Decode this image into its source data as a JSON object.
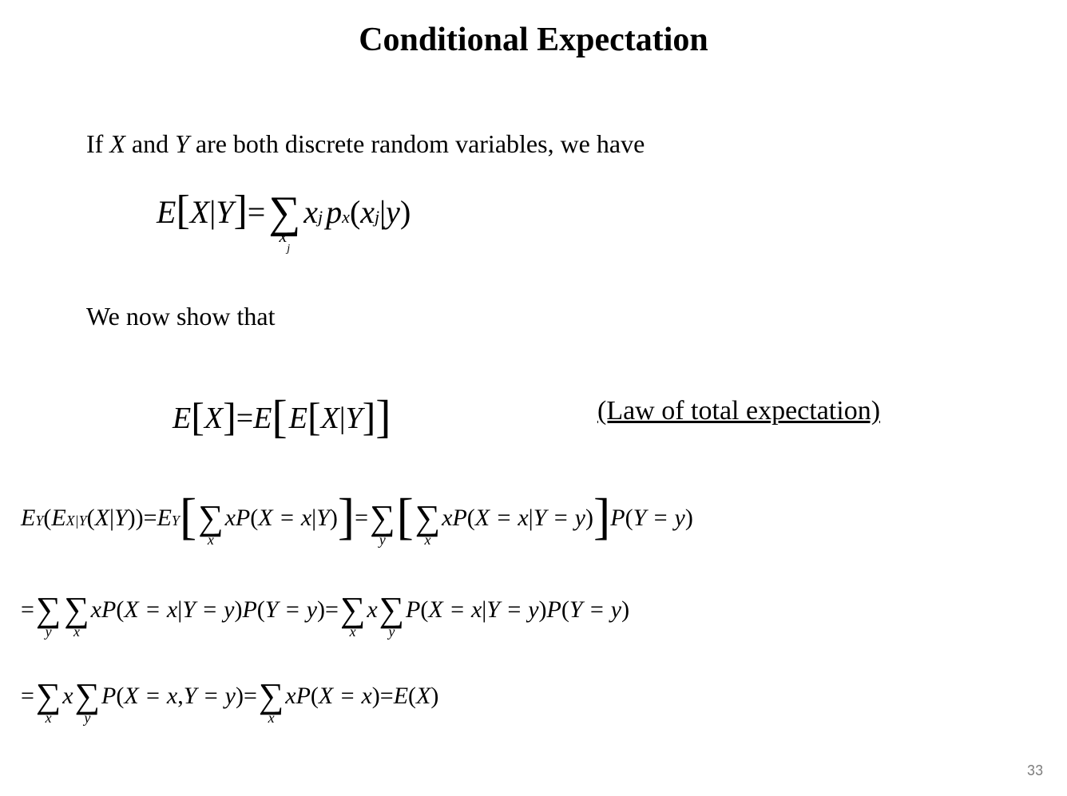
{
  "title": "Conditional Expectation",
  "intro_prefix": "If ",
  "intro_X": "X",
  "intro_mid": " and ",
  "intro_Y": "Y",
  "intro_suffix": " are both discrete random variables, we have",
  "we_now_show": "We now show that",
  "eq1": {
    "E": "E",
    "lb": "[",
    "X": "X",
    "bar": " | ",
    "Y": "Y",
    "rb": "]",
    "eq": " = ",
    "sigma": "∑",
    "sigma_sub": "x",
    "sigma_sub_j": "j",
    "xj_x": "x",
    "xj_j": "j",
    "p": "p",
    "p_sub": "x",
    "lp": "(",
    "arg_x": "x",
    "arg_j": "j",
    "arg_bar": " | ",
    "arg_y": "y",
    "rp": ")"
  },
  "eq2": {
    "E1": "E",
    "lb1": "[",
    "X": "X",
    "rb1": "]",
    "eq": " = ",
    "E2": "E",
    "lb2": "[",
    "E3": "E",
    "lb3": "[",
    "X2": "X",
    "bar": " | ",
    "Y": "Y",
    "rb3": "]",
    "rb2": "]"
  },
  "law_label": "(Law of total expectation)",
  "d1": {
    "EY": "E",
    "Ysub": "Y",
    "lp1": "(",
    "EXY": "E",
    "XYsub": "X|Y",
    "lp2": "(",
    "X": "X",
    "bar": " | ",
    "Y": "Y",
    "rp2": "))",
    "eq1": " = ",
    "EY2": "E",
    "Ysub2": "Y",
    "lbr": "[",
    "sigma1": "∑",
    "sigma1sub": "x",
    "xP": "xP",
    "lp3": "(",
    "Xeqx": "X = x",
    "bar2": " | ",
    "Y2": "Y",
    "rp3": ")",
    "rbr": "]",
    "eq2": " = ",
    "sigma2": "∑",
    "sigma2sub": "y",
    "lbr2": "[",
    "sigma3": "∑",
    "sigma3sub": "x",
    "xP2": "xP",
    "lp4": "(",
    "Xeqx2": "X = x",
    "bar3": " | ",
    "Yeqy": "Y = y",
    "rp4": ")",
    "rbr2": "]",
    "P": "P",
    "lp5": "(",
    "Yeqy2": "Y = y",
    "rp5": ")"
  },
  "d2": {
    "eq1": "= ",
    "sigma1": "∑",
    "sigma1sub": "y",
    "sigma2": "∑",
    "sigma2sub": "x",
    "xP": "xP",
    "lp1": "(",
    "Xeqx": "X = x",
    "bar": " | ",
    "Yeqy": "Y = y",
    "rp1": ")",
    "P": "P",
    "lp2": "(",
    "Yeqy2": "Y = y",
    "rp2": ")",
    "eq2": " = ",
    "sigma3": "∑",
    "sigma3sub": "x",
    "x": "x",
    "sigma4": "∑",
    "sigma4sub": "y",
    "P2": "P",
    "lp3": "(",
    "Xeqx2": "X = x",
    "bar2": " | ",
    "Yeqy3": "Y = y",
    "rp3": ")",
    "P3": "P",
    "lp4": "(",
    "Yeqy4": "Y = y",
    "rp4": ")"
  },
  "d3": {
    "eq1": "= ",
    "sigma1": "∑",
    "sigma1sub": "x",
    "x": "x",
    "sigma2": "∑",
    "sigma2sub": "y",
    "P": "P",
    "lp1": "(",
    "Xeqx": "X = x",
    "comma": ", ",
    "Yeqy": "Y = y",
    "rp1": ")",
    "eq2": " = ",
    "sigma3": "∑",
    "sigma3sub": "x",
    "xP": "xP",
    "lp2": "(",
    "Xeqx2": "X = x",
    "rp2": ")",
    "eq3": " = ",
    "E": "E",
    "lp3": "(",
    "X": "X",
    "rp3": ")"
  },
  "page_number": "33"
}
